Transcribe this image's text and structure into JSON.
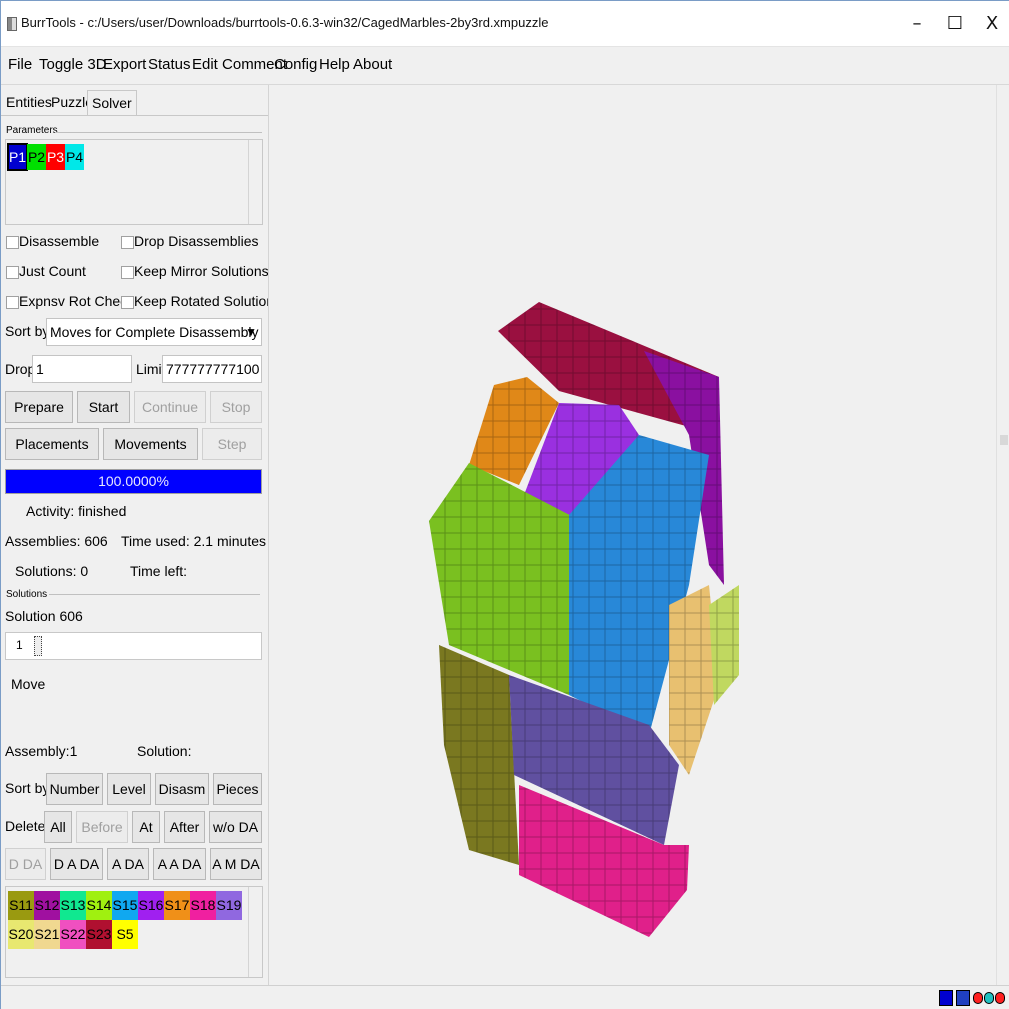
{
  "window": {
    "title": "BurrTools - c:/Users/user/Downloads/burrtools-0.6.3-win32/CagedMarbles-2by3rd.xmpuzzle",
    "minimize": "–",
    "maximize": "☐",
    "close": "X"
  },
  "menu": [
    "File",
    "Toggle 3D",
    "Export",
    "Status",
    "Edit Comment",
    "Config",
    "Help",
    "About"
  ],
  "tabs": [
    "Entities",
    "Puzzle",
    "Solver"
  ],
  "active_tab": "Solver",
  "parameters": {
    "label": "Parameters",
    "chips": [
      {
        "label": "P1",
        "color": "#0000d0",
        "text_color": "#ffffff"
      },
      {
        "label": "P2",
        "color": "#00e000",
        "text_color": "#000000"
      },
      {
        "label": "P3",
        "color": "#ff0000",
        "text_color": "#ffffff"
      },
      {
        "label": "P4",
        "color": "#00e8e8",
        "text_color": "#000000"
      }
    ]
  },
  "options": {
    "disassemble": "Disassemble",
    "drop_disassemblies": "Drop Disassemblies",
    "just_count": "Just Count",
    "keep_mirror": "Keep Mirror Solutions",
    "expnsv_rot": "Expnsv Rot Check",
    "keep_rotated": "Keep Rotated Solutions"
  },
  "sort": {
    "label": "Sort by:",
    "value": "Moves for Complete Disassembly",
    "arrow": "▼"
  },
  "drop": {
    "label": "Drop",
    "value": "1"
  },
  "limit": {
    "label": "Limit",
    "value": "777777777100"
  },
  "buttons1": {
    "prepare": "Prepare",
    "start": "Start",
    "continue": "Continue",
    "stop": "Stop"
  },
  "buttons2": {
    "placements": "Placements",
    "movements": "Movements",
    "step": "Step"
  },
  "progress": {
    "text": "100.0000%",
    "fraction": 1.0,
    "color": "#0000ff"
  },
  "stats": {
    "activity": "Activity: finished",
    "assemblies": "Assemblies: 606",
    "time_used": "Time used: 2.1 minutes",
    "solutions": "Solutions: 0",
    "time_left": "Time left:"
  },
  "solutions": {
    "group_label": "Solutions",
    "solution_label": "Solution 606",
    "slider_value": "1",
    "move_label": "Move",
    "assembly": "Assembly:1",
    "solution": "Solution:"
  },
  "sort2": {
    "label": "Sort by:",
    "buttons": [
      "Number",
      "Level",
      "Disasm",
      "Pieces"
    ]
  },
  "delete": {
    "label": "Delete:",
    "all": "All",
    "before": "Before",
    "at": "At",
    "after": "After",
    "wo_da": "w/o DA"
  },
  "da_buttons": {
    "d_da": "D DA",
    "d_a_da": "D A DA",
    "a_da": "A DA",
    "a_a_da": "A A DA",
    "a_m_da": "A M DA"
  },
  "pieces": [
    {
      "label": "S11",
      "color": "#9a9a10"
    },
    {
      "label": "S12",
      "color": "#a010a0"
    },
    {
      "label": "S13",
      "color": "#10e890"
    },
    {
      "label": "S14",
      "color": "#a0f010"
    },
    {
      "label": "S15",
      "color": "#10a8f0"
    },
    {
      "label": "S16",
      "color": "#a020f0"
    },
    {
      "label": "S17",
      "color": "#f09018"
    },
    {
      "label": "S18",
      "color": "#f020a0"
    },
    {
      "label": "S19",
      "color": "#9068e0"
    },
    {
      "label": "S20",
      "color": "#e8e870"
    },
    {
      "label": "S21",
      "color": "#f0d890"
    },
    {
      "label": "S22",
      "color": "#f050c0"
    },
    {
      "label": "S23",
      "color": "#b01030"
    },
    {
      "label": "S5",
      "color": "#ffff00"
    }
  ]
}
